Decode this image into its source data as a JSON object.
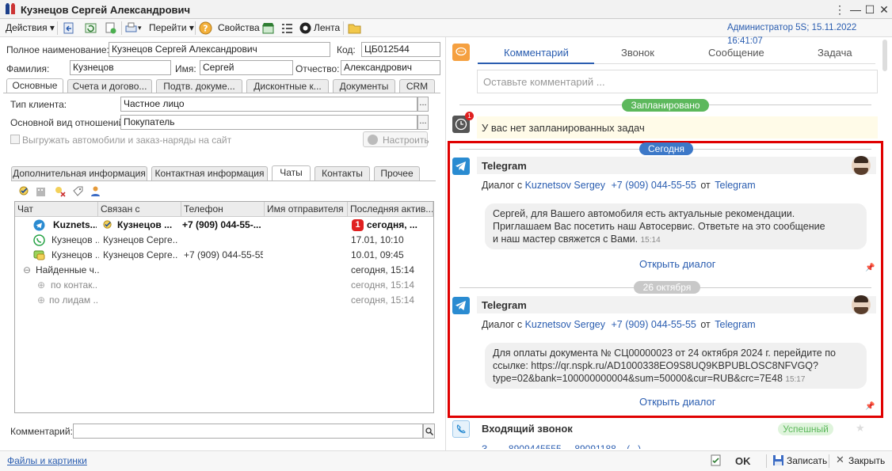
{
  "window": {
    "title": "Кузнецов Сергей Александрович",
    "controls": [
      "⋮",
      "—",
      "☐",
      "✕"
    ]
  },
  "toolbar": {
    "actions": "Действия",
    "go": "Перейти",
    "properties": "Свойства",
    "feed": "Лента",
    "user_info": "Администратор 5S; 15.11.2022 16:41:07"
  },
  "form": {
    "full_name_label": "Полное наименование:",
    "full_name": "Кузнецов Сергей Александрович",
    "code_label": "Код:",
    "code": "ЦБ012544",
    "surname_label": "Фамилия:",
    "surname": "Кузнецов",
    "name_label": "Имя:",
    "name": "Сергей",
    "patronymic_label": "Отчество:",
    "patronymic": "Александрович",
    "tabs": [
      "Основные",
      "Счета и догово...",
      "Подтв. докуме...",
      "Дисконтные к...",
      "Документы",
      "CRM"
    ],
    "client_type_label": "Тип клиента:",
    "client_type": "Частное лицо",
    "relation_label": "Основной вид отношений:",
    "relation": "Покупатель",
    "export_label": "Выгружать автомобили и заказ-наряды на сайт",
    "configure_label": "Настроить",
    "subtabs": [
      "Дополнительная информация",
      "Контактная информация",
      "Чаты",
      "Контакты",
      "Прочее"
    ],
    "grid_headers": [
      "Чат",
      "Связан с",
      "Телефон",
      "Имя отправителя",
      "Последняя актив..."
    ],
    "rows": [
      {
        "chat": "Kuznets...",
        "linked": "Кузнецов ...",
        "phone": "+7 (909) 044-55-...",
        "sender": "",
        "last": "сегодня, ...",
        "badge": "1"
      },
      {
        "chat": "Кузнецов ...",
        "linked": "Кузнецов Серге...",
        "phone": "",
        "sender": "",
        "last": "17.01, 10:10"
      },
      {
        "chat": "Кузнецов ...",
        "linked": "Кузнецов Серге...",
        "phone": "+7 (909) 044-55-55",
        "sender": "",
        "last": "10.01, 09:45"
      },
      {
        "chat": "Найденные ч...",
        "linked": "",
        "phone": "",
        "sender": "",
        "last": "сегодня, 15:14"
      },
      {
        "chat": "по контак...",
        "linked": "",
        "phone": "",
        "sender": "",
        "last": "сегодня, 15:14"
      },
      {
        "chat": "по лидам ...",
        "linked": "",
        "phone": "",
        "sender": "",
        "last": "сегодня, 15:14"
      }
    ],
    "comment_label": "Комментарий:"
  },
  "right": {
    "tabs": [
      "Комментарий",
      "Звонок",
      "Сообщение",
      "Задача"
    ],
    "comment_placeholder": "Оставьте комментарий ...",
    "planned_pill": "Запланировано",
    "no_tasks": "У вас нет запланированных задач",
    "today_pill": "Сегодня",
    "date_pill": "26 октября",
    "card1": {
      "title": "Telegram",
      "dialog_with": "Диалог с",
      "contact": "Kuznetsov Sergey",
      "phone": "+7 (909) 044-55-55",
      "from": "от",
      "channel": "Telegram",
      "message_lines": [
        "Сергей, для Вашего автомобиля есть актуальные рекомендации.",
        "Приглашаем Вас посетить наш Автосервис. Ответьте на это сообщение",
        "и наш мастер свяжется с Вами."
      ],
      "time": "15:14",
      "open": "Открыть диалог"
    },
    "card2": {
      "title": "Telegram",
      "dialog_with": "Диалог с",
      "contact": "Kuznetsov Sergey",
      "phone": "+7 (909) 044-55-55",
      "from": "от",
      "channel": "Telegram",
      "message_lines": [
        "Для оплаты документа № СЦ00000023 от 24 октября 2024 г. перейдите по",
        "ссылке: https://qr.nspk.ru/AD1000338EO9S8UQ9KBPUBLOSC8NFVGQ?",
        "type=02&bank=100000000004&sum=50000&cur=RUB&crc=7E48"
      ],
      "time": "15:17",
      "open": "Открыть диалог"
    },
    "call": {
      "title": "Входящий звонок",
      "status": "Успешный",
      "partial": "З... ...  8909445555 ... 89091188... (...)"
    },
    "task_badge": "1"
  },
  "status": {
    "files": "Файлы и картинки",
    "ok": "OK",
    "save": "Записать",
    "close": "Закрыть"
  },
  "colors": {
    "accent": "#2a5db0",
    "green": "#5cb85c",
    "blue_pill": "#3c78c8",
    "red_frame": "#e00000",
    "telegram": "#2a8bd1"
  }
}
